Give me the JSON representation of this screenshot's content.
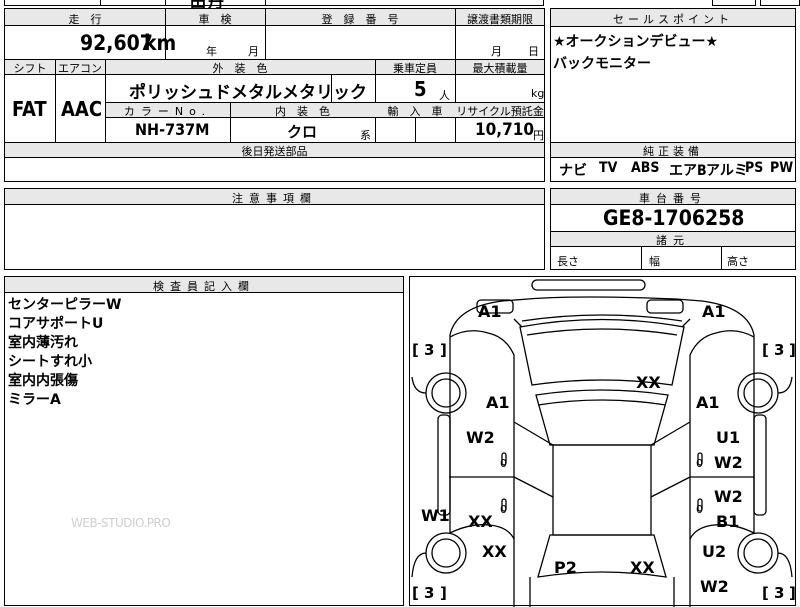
{
  "top_cut": {
    "c2": "田",
    "c3": "丹"
  },
  "main": {
    "hdr_mileage": "走　行",
    "hdr_shaken": "車　検",
    "hdr_reg": "登　録　番　号",
    "hdr_transfer": "譲渡書類期限",
    "mileage": "92,607",
    "mileage_unit": "km",
    "shaken_year": "年",
    "shaken_month": "月",
    "transfer_month": "月",
    "transfer_day": "日",
    "hdr_shift": "シフト",
    "hdr_ac": "エアコン",
    "hdr_exterior": "外　装　色",
    "hdr_capacity": "乗車定員",
    "hdr_load": "最大積載量",
    "shift": "FAT",
    "ac": "AAC",
    "exterior": "ポリッシュドメタルメタリック",
    "capacity": "5",
    "capacity_unit": "人",
    "load_unit": "kg",
    "hdr_color_no": "カラーNo.",
    "hdr_interior": "内　装　色",
    "hdr_import": "輸　入　車",
    "hdr_recycle": "リサイクル預託金",
    "color_no": "NH-737M",
    "interior": "クロ",
    "interior_suffix": "系",
    "recycle": "10,710",
    "recycle_unit": "円",
    "hdr_later_parts": "後日発送部品"
  },
  "sales": {
    "header": "セールスポイント",
    "lines": [
      "★オークションデビュー★",
      "バックモニター"
    ]
  },
  "equipment": {
    "header": "純正装備",
    "items": [
      "ナビ",
      "TV",
      "ABS",
      "エアB",
      "アルミ",
      "PS",
      "PW"
    ]
  },
  "caution": {
    "header": "注意事項欄"
  },
  "chassis": {
    "header": "車台番号",
    "number": "GE8-1706258"
  },
  "dims": {
    "header": "諸元",
    "length": "長さ",
    "width": "幅",
    "height": "高さ"
  },
  "inspector": {
    "header": "検査員記入欄",
    "lines": [
      "センターピラーW",
      "コアサポートU",
      "室内薄汚れ",
      "シートすれ小",
      "室内内張傷",
      "ミラーA"
    ]
  },
  "watermark": "WEB-STUDIO.PRO",
  "diagram": {
    "br_open": "[",
    "br_close": "]",
    "n3": "3",
    "a1": "A1",
    "xx": "XX",
    "w2": "W2",
    "u1": "U1",
    "w1": "W1",
    "b1": "B1",
    "u2": "U2",
    "p2": "P2",
    "zero": "0"
  }
}
